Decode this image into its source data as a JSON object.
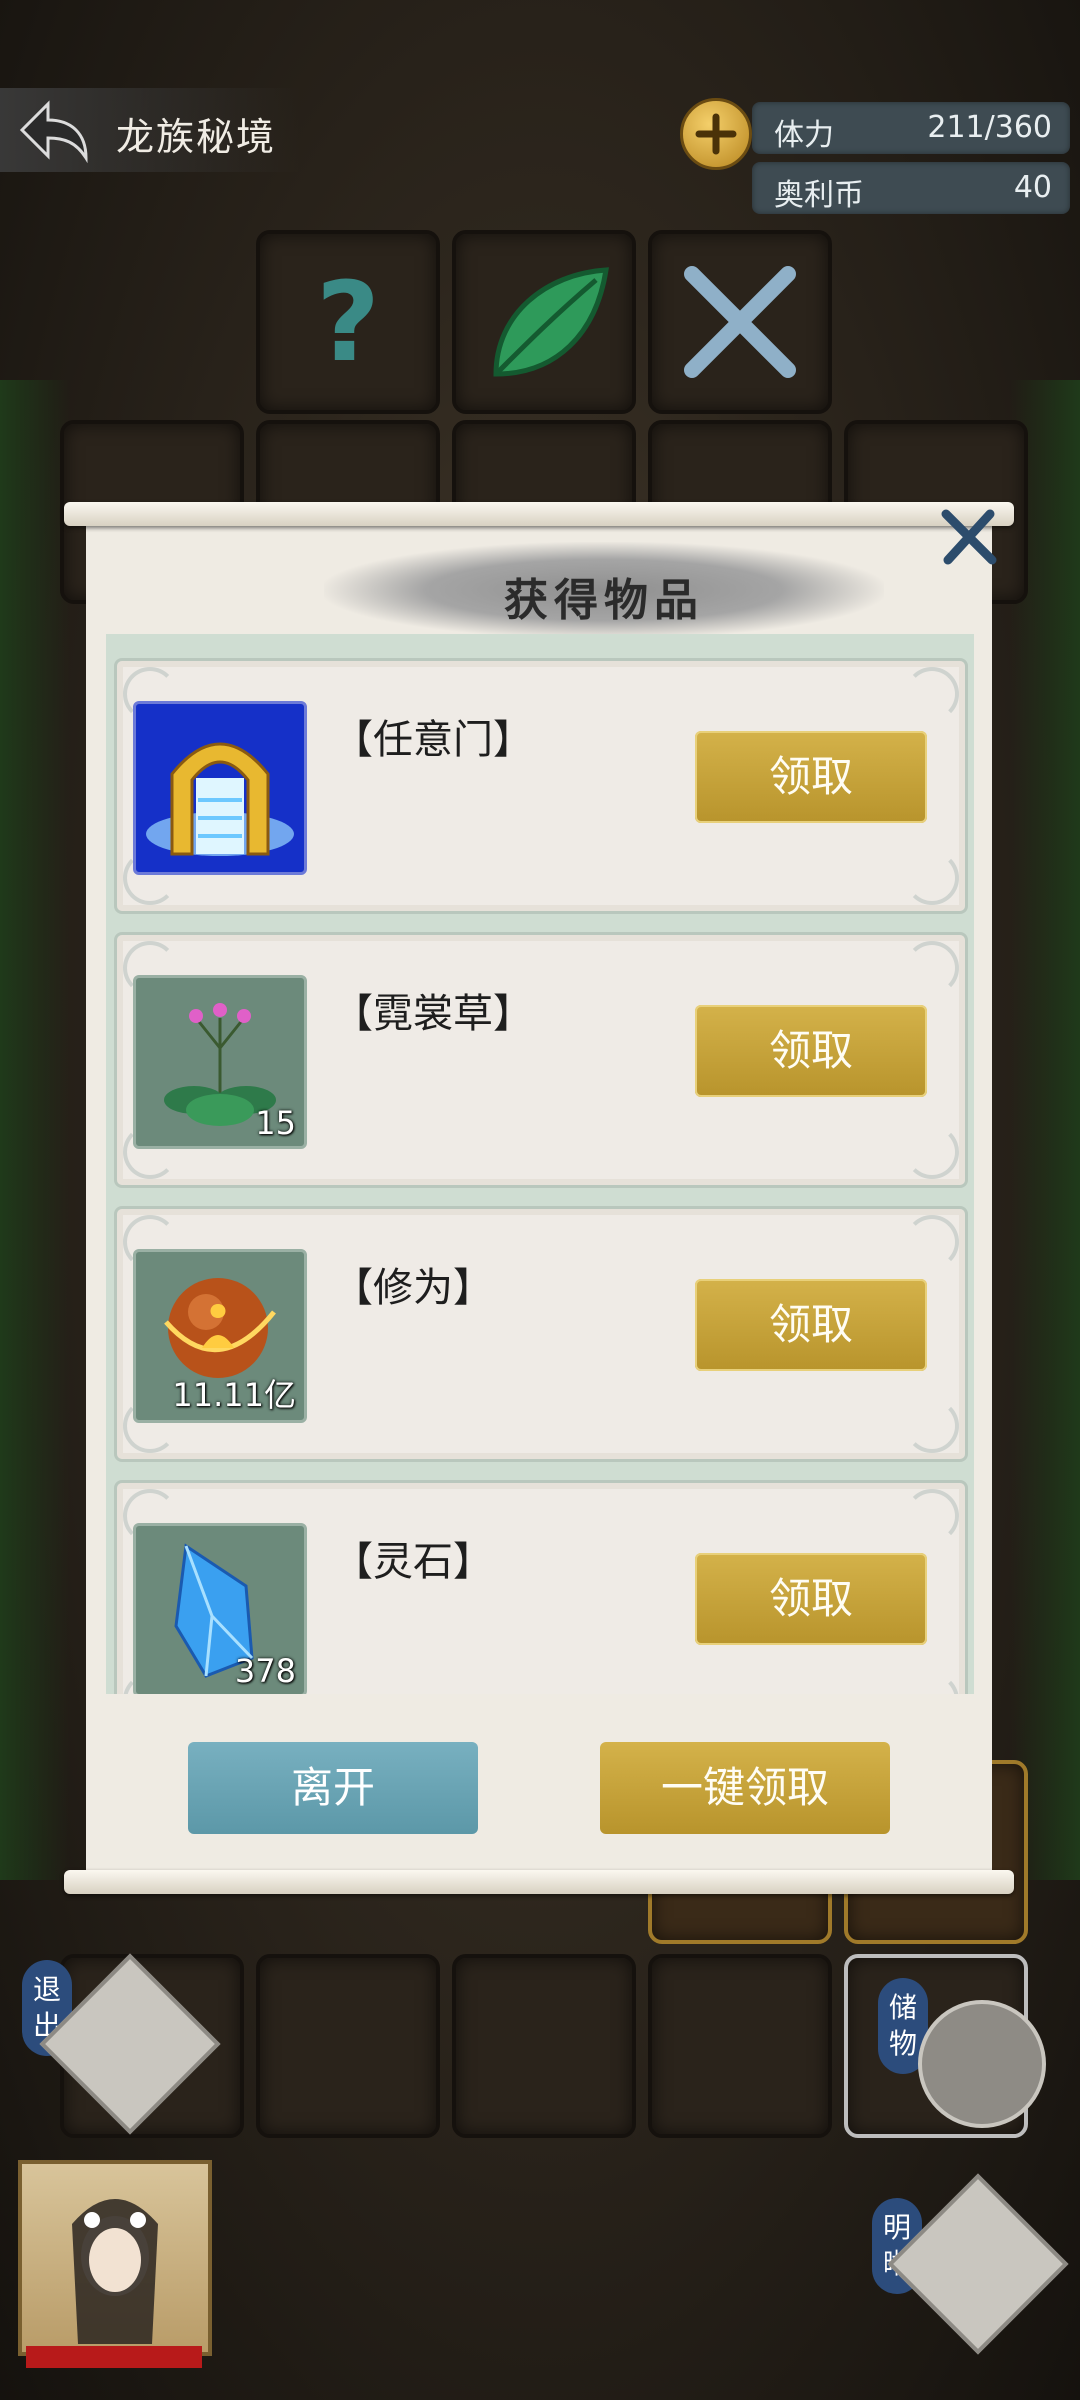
{
  "header": {
    "title": "龙族秘境",
    "stats": [
      {
        "label": "体力",
        "value": "211/360"
      },
      {
        "label": "奥利币",
        "value": "40"
      }
    ]
  },
  "dialog": {
    "title": "获得物品",
    "claim_label": "领取",
    "items": [
      {
        "name": "【任意门】",
        "count": "",
        "icon": "golden-gate-icon"
      },
      {
        "name": "【霓裳草】",
        "count": "15",
        "icon": "herb-plant-icon"
      },
      {
        "name": "【修为】",
        "count": "11.11亿",
        "icon": "cultivation-orb-icon"
      },
      {
        "name": "【灵石】",
        "count": "378",
        "icon": "spirit-crystal-icon"
      }
    ],
    "leave_label": "离开",
    "claim_all_label": "一键领取"
  },
  "bottom": {
    "exit_label": "退出",
    "storage_label": "储物",
    "clear_label": "明晰"
  },
  "colors": {
    "claim_gold": "#c9a63c",
    "leave_teal": "#6aa4b4",
    "stat_bg": "#3e4b52"
  }
}
